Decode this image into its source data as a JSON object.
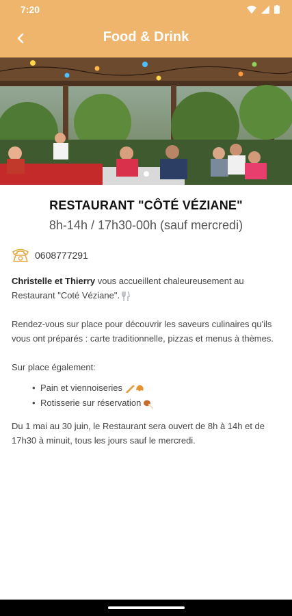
{
  "status_bar": {
    "time": "7:20"
  },
  "app_bar": {
    "title": "Food & Drink",
    "back_icon": "chevron-left-icon"
  },
  "hero": {
    "pager_count": 1,
    "active_index": 0
  },
  "place": {
    "name": "RESTAURANT \"CÔTÉ VÉZIANE\"",
    "hours": "8h-14h / 17h30-00h (sauf mercredi)",
    "phone": "0608777291"
  },
  "description": {
    "p1_bold": "Christelle et Thierry",
    "p1_rest": " vous accueillent chaleureusement au Restaurant \"Coté Véziane\".",
    "p2": "Rendez-vous sur place pour découvrir les saveurs culinaires qu'ils vous ont préparés : carte traditionnelle, pizzas et menus à thèmes.",
    "p3": "Sur place également:",
    "bullets": [
      "Pain et viennoiseries",
      "Rotisserie sur réservation"
    ],
    "p4": "Du 1 mai au 30 juin, le Restaurant sera ouvert de 8h à 14h et de 17h30 à minuit, tous les jours sauf le mercredi."
  },
  "colors": {
    "accent": "#f0b56c",
    "text": "#444444"
  }
}
